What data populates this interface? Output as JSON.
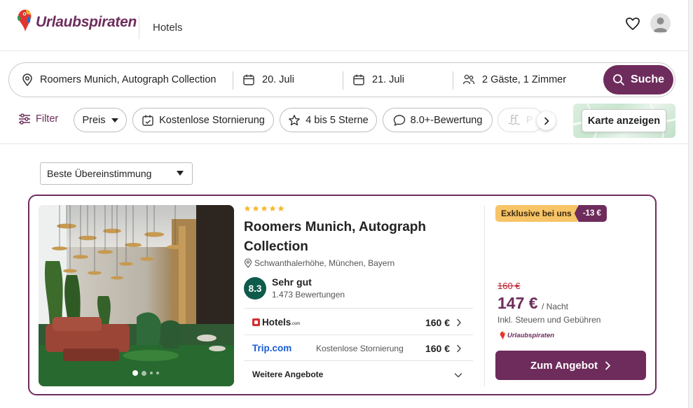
{
  "header": {
    "logo_text": "Urlaubspiraten",
    "nav_label": "Hotels"
  },
  "search": {
    "destination": "Roomers Munich, Autograph Collection",
    "checkin": "20. Juli",
    "checkout": "21. Juli",
    "guests": "2 Gäste, 1 Zimmer",
    "search_label": "Suche"
  },
  "filters": {
    "filter_label": "Filter",
    "chips": [
      "Preis",
      "Kostenlose Stornierung",
      "4 bis 5 Sterne",
      "8.0+-Bewertung",
      "P"
    ],
    "map_button": "Karte anzeigen"
  },
  "sort": {
    "selected": "Beste Übereinstimmung"
  },
  "hotel": {
    "stars": 5,
    "name": "Roomers Munich, Autograph Collection",
    "location": "Schwanthalerhöhe, München, Bayern",
    "rating": "8.3",
    "rating_label": "Sehr gut",
    "reviews": "1.473 Bewertungen",
    "photo_count": 4,
    "photo_active_index": 0,
    "offers": [
      {
        "provider": "Hotels",
        "provider_suffix": ".com",
        "note": "",
        "price": "160 €"
      },
      {
        "provider": "Trip.com",
        "note": "Kostenlose Stornierung",
        "price": "160 €"
      }
    ],
    "more_offers": "Weitere Angebote",
    "badge_exclusive": "Exklusive bei uns",
    "badge_discount": "-13 €",
    "old_price": "160 €",
    "new_price": "147 €",
    "per_night": "/ Nacht",
    "taxes": "Inkl. Steuern und Gebühren",
    "small_logo_text": "Urlaubspiraten",
    "cta_label": "Zum Angebot"
  },
  "colors": {
    "brand": "#6e2c5c",
    "rating": "#0f5b4b",
    "badge": "#f7c468",
    "strike": "#c0202e",
    "star": "#f5b82e"
  }
}
